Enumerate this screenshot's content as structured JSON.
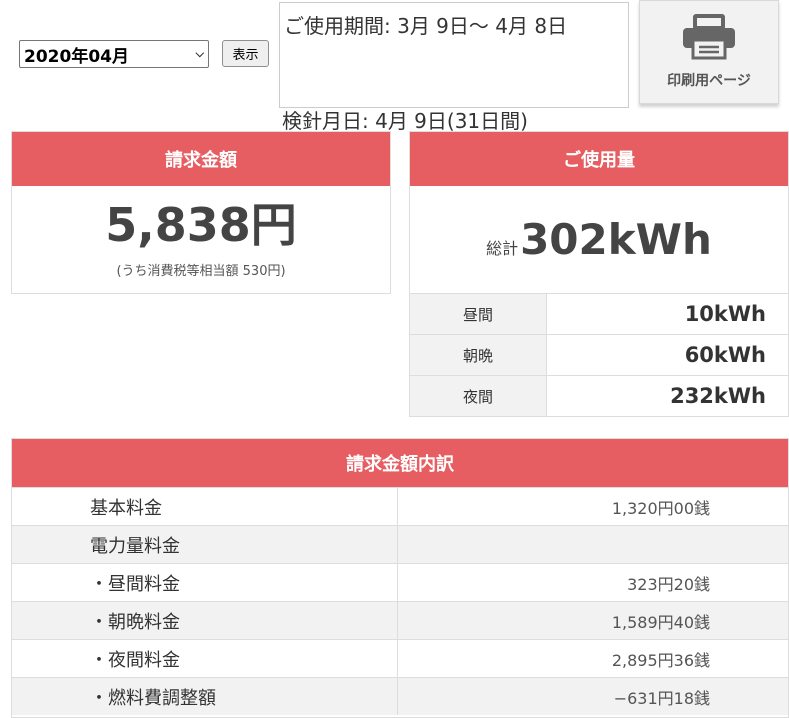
{
  "month_select": {
    "value": "2020年04月"
  },
  "show_button": "表示",
  "usage_period": "ご使用期間: 3月 9日〜 4月 8日",
  "meter_read_date": "検針月日: 4月 9日(31日間)",
  "print_button": {
    "label": "印刷用ページ",
    "icon": "printer-icon"
  },
  "billing": {
    "title": "請求金額",
    "amount": "5,838円",
    "tax_note": "(うち消費税等相当額 530円)"
  },
  "usage": {
    "title": "ご使用量",
    "total_label": "総計",
    "total_value": "302kWh",
    "rows": [
      {
        "label": "昼間",
        "value": "10kWh"
      },
      {
        "label": "朝晩",
        "value": "60kWh"
      },
      {
        "label": "夜間",
        "value": "232kWh"
      }
    ]
  },
  "breakdown": {
    "title": "請求金額内訳",
    "rows": [
      {
        "label": "基本料金",
        "value": "1,320円00銭"
      },
      {
        "label": "電力量料金",
        "value": ""
      },
      {
        "label": "・昼間料金",
        "value": "323円20銭"
      },
      {
        "label": "・朝晩料金",
        "value": "1,589円40銭"
      },
      {
        "label": "・夜間料金",
        "value": "2,895円36銭"
      },
      {
        "label": "・燃料費調整額",
        "value": "−631円18銭"
      }
    ]
  },
  "colors": {
    "accent": "#e65e62",
    "row_alt": "#f2f2f2",
    "border": "#dddddd"
  }
}
